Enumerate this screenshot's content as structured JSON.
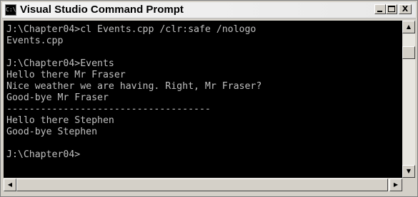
{
  "window": {
    "title": "Visual Studio Command Prompt",
    "icon": "C:\\",
    "controls": {
      "minimize": "minimize",
      "maximize": "maximize",
      "close": "X"
    }
  },
  "console": {
    "lines": [
      "J:\\Chapter04>cl Events.cpp /clr:safe /nologo",
      "Events.cpp",
      "",
      "J:\\Chapter04>Events",
      "Hello there Mr Fraser",
      "Nice weather we are having. Right, Mr Fraser?",
      "Good-bye Mr Fraser",
      "------------------------------------",
      "Hello there Stephen",
      "Good-bye Stephen",
      "",
      "J:\\Chapter04>"
    ]
  },
  "scrollbars": {
    "up_arrow": "▲",
    "down_arrow": "▼",
    "left_arrow": "◀",
    "right_arrow": "▶"
  }
}
